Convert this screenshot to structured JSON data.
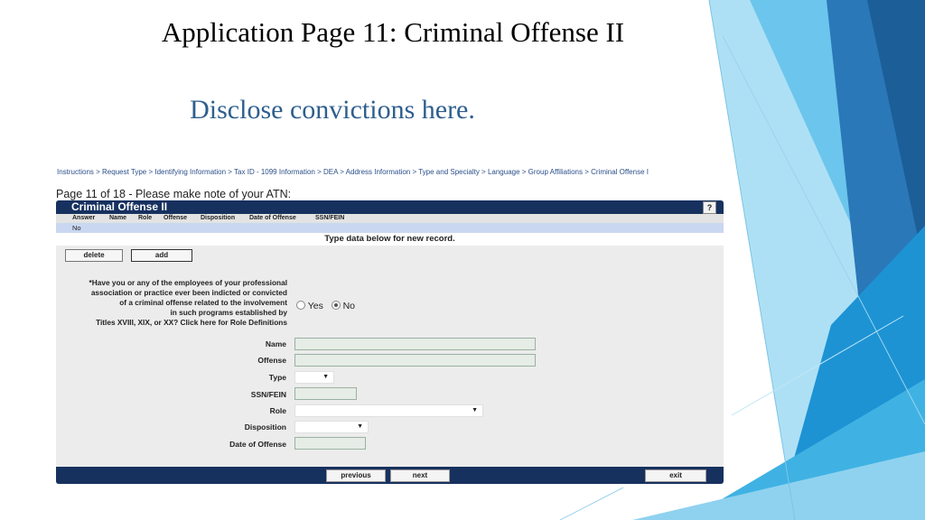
{
  "slide": {
    "title": "Application Page 11:  Criminal Offense II",
    "subtitle": "Disclose convictions here."
  },
  "breadcrumb": {
    "text": "Instructions  >  Request Type  >  Identifying Information  >  Tax ID - 1099 Information  >  DEA  >  Address Information  >  Type and Specialty  >  Language  >  Group Affiliations  >  Criminal Offense I"
  },
  "page_note": "Page 11 of 18 - Please make note of your ATN:",
  "panel": {
    "title": "Criminal Offense II",
    "help": "?",
    "columns": [
      "Answer",
      "Name",
      "Role",
      "Offense",
      "Disposition",
      "Date of Offense",
      "SSN/FEIN"
    ],
    "rows": [
      "No"
    ],
    "new_record_text": "Type data below for new record.",
    "delete_label": "delete",
    "add_label": "add"
  },
  "question": {
    "line1": "*Have you or any of the employees of your professional",
    "line2": "association or practice ever been indicted or convicted",
    "line3": "of a criminal offense related to the involvement",
    "line4": "in such programs established by",
    "line5": "Titles XVIII, XIX, or XX? Click here for Role Definitions",
    "yes_label": "Yes",
    "no_label": "No",
    "selected": "No"
  },
  "fields": {
    "name_label": "Name",
    "offense_label": "Offense",
    "type_label": "Type",
    "ssn_label": "SSN/FEIN",
    "role_label": "Role",
    "disposition_label": "Disposition",
    "date_label": "Date of Offense"
  },
  "footer": {
    "previous_label": "previous",
    "next_label": "next",
    "exit_label": "exit"
  },
  "colors": {
    "panel_header": "#17315f",
    "row_highlight": "#c9d7f1",
    "subtitle": "#2e5f8e",
    "deco_blue": "#1e8fd0"
  }
}
